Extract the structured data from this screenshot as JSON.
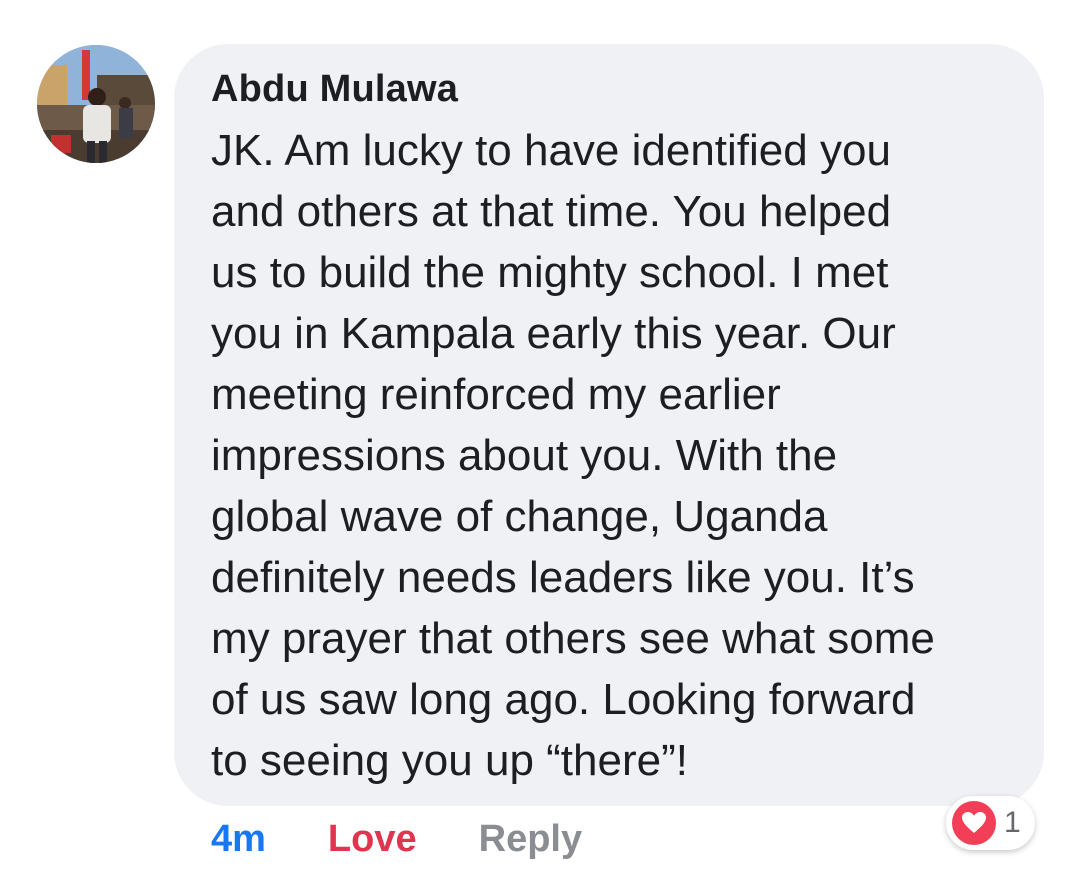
{
  "comment": {
    "author": "Abdu Mulawa",
    "text": "JK. Am lucky to have identified you\nand others at that time. You helped\nus to build the mighty school. I met\nyou in Kampala early this year. Our\nmeeting reinforced my earlier\nimpressions about you. With the\nglobal wave of change, Uganda\ndefinitely needs leaders like you. It’s\nmy prayer that others see what some\nof us saw long ago. Looking forward\nto seeing you up “there”!",
    "avatar_icon": "avatar-photo"
  },
  "actions": {
    "time": "4m",
    "love_label": "Love",
    "reply_label": "Reply"
  },
  "reaction": {
    "icon": "heart-icon",
    "count": "1"
  },
  "colors": {
    "bubble": "#f0f1f4",
    "time": "#1877f2",
    "love": "#e0344f",
    "reply": "#8a8d91",
    "heart": "#f33e58"
  }
}
